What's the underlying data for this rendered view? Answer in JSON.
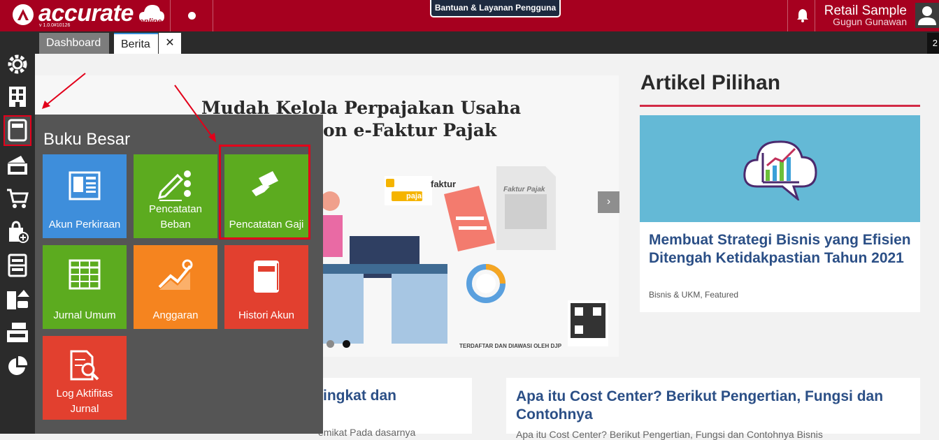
{
  "header": {
    "logo_text": "accurate",
    "logo_sub": "online",
    "version": "v 1.0.0#10126",
    "help_label": "Bantuan & Layanan Pengguna",
    "user_title": "Retail Sample",
    "user_name": "Gugun Gunawan"
  },
  "tabs": {
    "dashboard": "Dashboard",
    "berita": "Berita",
    "close": "✕",
    "right_indicator": "2"
  },
  "sidebar": {
    "items": [
      "settings-icon",
      "company-icon",
      "ledger-icon",
      "cash-bank-icon",
      "sales-cart-icon",
      "purchase-bag-icon",
      "inventory-icon",
      "asset-building-icon",
      "tax-icon",
      "report-chart-icon"
    ]
  },
  "menu": {
    "title": "Buku Besar",
    "tiles": [
      {
        "label": "Akun Perkiraan",
        "color": "#3e8edb"
      },
      {
        "label": "Pencatatan Beban",
        "color": "#5cab1f"
      },
      {
        "label": "Pencatatan Gaji",
        "color": "#5cab1f"
      },
      {
        "label": "Jurnal Umum",
        "color": "#5cab1f"
      },
      {
        "label": "Anggaran",
        "color": "#f5841f"
      },
      {
        "label": "Histori Akun",
        "color": "#e2402f"
      },
      {
        "label": "Log Aktifitas Jurnal",
        "color": "#e2402f"
      }
    ]
  },
  "hero": {
    "title_line1": "Mudah Kelola Perpajakan Usaha",
    "title_line2": "on e-Faktur Pajak",
    "efaktur_label": "faktur",
    "efaktur_sub": "pajak",
    "doc_label": "Faktur Pajak",
    "footer": "TERDAFTAR DAN DIAWASI OLEH DJP",
    "next": "›"
  },
  "articles": {
    "panel_title": "Artikel Pilihan",
    "featured": {
      "title": "Membuat Strategi Bisnis yang Efisien Ditengah Ketidakpastian Tahun 2021",
      "category": "Bisnis & UKM, Featured"
    },
    "bottom1": {
      "title": "ingkat dan",
      "snippet": "emikat Pada dasarnya"
    },
    "bottom2": {
      "title": "Apa itu Cost Center? Berikut Pengertian, Fungsi dan Contohnya",
      "snippet": "Apa itu Cost Center? Berikut Pengertian, Fungsi dan Contohnya Bisnis"
    }
  },
  "colors": {
    "brand": "#a6001f",
    "highlight": "#e2001a"
  }
}
